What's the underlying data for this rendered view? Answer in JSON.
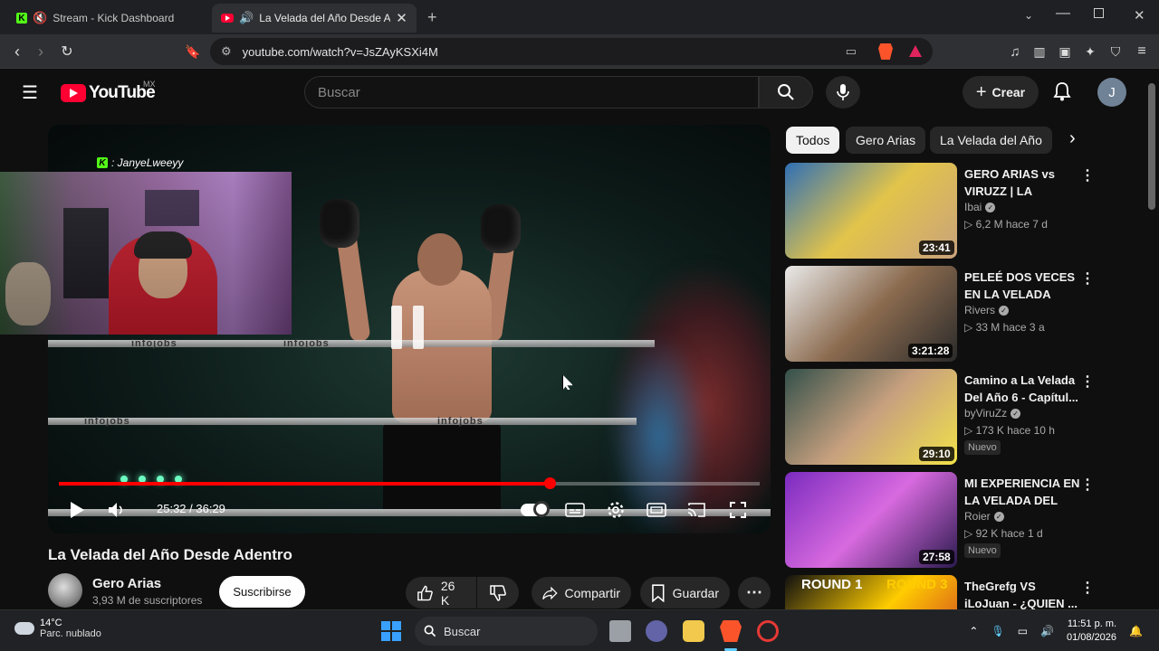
{
  "browser": {
    "tabs": [
      {
        "label": "Stream - Kick Dashboard",
        "favicon": "kick-icon",
        "muted": true
      },
      {
        "label": "La Velada del Año Desde Adentro",
        "favicon": "youtube-icon",
        "audio": true,
        "active": true
      }
    ],
    "url": "youtube.com/watch?v=JsZAyKSXi4M",
    "shield_count": "0"
  },
  "youtube": {
    "logo_text": "YouTube",
    "country": "MX",
    "search_placeholder": "Buscar",
    "create_label": "Crear",
    "avatar_letter": "J"
  },
  "stream_overlay": {
    "handle": ": JanyeLweeyy"
  },
  "player": {
    "current_time": "25:32",
    "duration": "36:29",
    "time_display": "25:32 / 36:29",
    "progress_fraction": 0.7,
    "ring_brand": "infojobs",
    "state": "paused"
  },
  "video": {
    "title": "La Velada del Año Desde Adentro",
    "channel": "Gero Arias",
    "subscribers": "3,93 M de suscriptores",
    "subscribe_label": "Suscribirse",
    "likes": "26 K",
    "share_label": "Compartir",
    "save_label": "Guardar"
  },
  "chips": [
    "Todos",
    "Gero Arias",
    "La Velada del Año"
  ],
  "recommendations": [
    {
      "title": "GERO ARIAS vs VIRUZZ | LA VELAD...",
      "channel": "Ibai",
      "verified": true,
      "meta": "▷ 6,2 M  hace 7 d",
      "duration": "23:41",
      "badge": "",
      "colors": [
        "#2f6fb5",
        "#e2c44a",
        "#c9a27d"
      ]
    },
    {
      "title": "PELEÉ DOS VECES EN LA VELADA DEL...",
      "channel": "Rivers",
      "verified": true,
      "meta": "▷ 33 M  hace 3 a",
      "duration": "3:21:28",
      "badge": "",
      "colors": [
        "#eaeaea",
        "#8b6b4f",
        "#2a2a2a"
      ]
    },
    {
      "title": "Camino a La Velada Del Año 6 - Capítul...",
      "channel": "byViruZz",
      "verified": true,
      "meta": "▷ 173 K  hace 10 h",
      "duration": "29:10",
      "badge": "Nuevo",
      "colors": [
        "#33504a",
        "#c7a07f",
        "#f2e14a"
      ]
    },
    {
      "title": "MI EXPERIENCIA EN LA VELADA DEL AÑ...",
      "channel": "Roier",
      "verified": true,
      "meta": "▷ 92 K  hace 1 d",
      "duration": "27:58",
      "badge": "Nuevo",
      "colors": [
        "#7b2bbf",
        "#d86adf",
        "#2a1a4e"
      ]
    },
    {
      "title": "TheGrefg VS iLoJuan - ¿QUIEN ...",
      "channel": "",
      "verified": false,
      "meta": "",
      "duration": "",
      "badge": "",
      "colors": [
        "#101010",
        "#ffcc00",
        "#c62828"
      ],
      "thumb_text_left": "ROUND 1",
      "thumb_text_right": "ROUND 3"
    }
  ],
  "taskbar": {
    "temp": "14°C",
    "weather": "Parc. nublado",
    "search_label": "Buscar",
    "time": "11:51 p. m.",
    "date": "01/08/2026"
  }
}
